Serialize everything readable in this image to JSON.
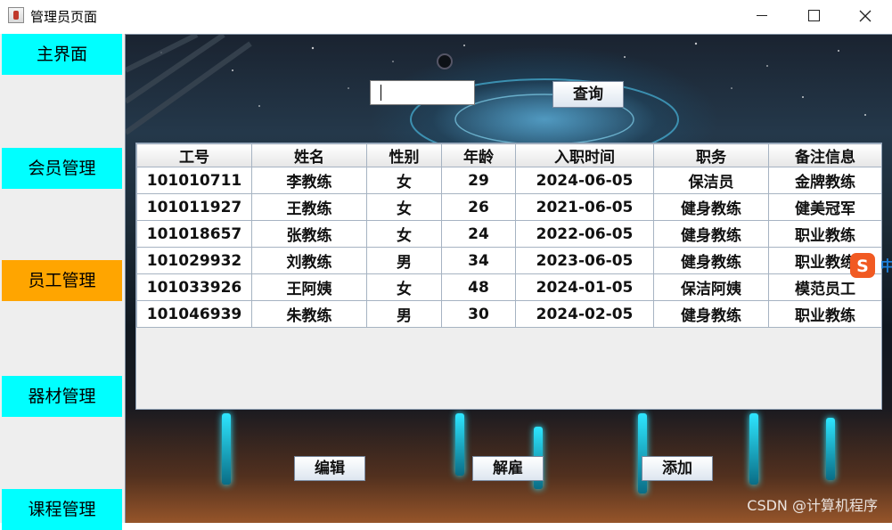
{
  "window": {
    "title": "管理员页面",
    "min_icon": "minimize-icon",
    "max_icon": "maximize-icon",
    "close_icon": "close-icon"
  },
  "sidebar": {
    "items": [
      {
        "label": "主界面",
        "active": false
      },
      {
        "label": "会员管理",
        "active": false
      },
      {
        "label": "员工管理",
        "active": true
      },
      {
        "label": "器材管理",
        "active": false
      },
      {
        "label": "课程管理",
        "active": false
      }
    ],
    "color_default": "#00ffff",
    "color_active": "#ffa500"
  },
  "search": {
    "value": "",
    "button_label": "查询"
  },
  "table": {
    "columns": [
      "工号",
      "姓名",
      "性别",
      "年龄",
      "入职时间",
      "职务",
      "备注信息"
    ],
    "rows": [
      [
        "101010711",
        "李教练",
        "女",
        "29",
        "2024-06-05",
        "保洁员",
        "金牌教练"
      ],
      [
        "101011927",
        "王教练",
        "女",
        "26",
        "2021-06-05",
        "健身教练",
        "健美冠军"
      ],
      [
        "101018657",
        "张教练",
        "女",
        "24",
        "2022-06-05",
        "健身教练",
        "职业教练"
      ],
      [
        "101029932",
        "刘教练",
        "男",
        "34",
        "2023-06-05",
        "健身教练",
        "职业教练"
      ],
      [
        "101033926",
        "王阿姨",
        "女",
        "48",
        "2024-01-05",
        "保洁阿姨",
        "模范员工"
      ],
      [
        "101046939",
        "朱教练",
        "男",
        "30",
        "2024-02-05",
        "健身教练",
        "职业教练"
      ]
    ]
  },
  "actions": {
    "edit_label": "编辑",
    "fire_label": "解雇",
    "add_label": "添加"
  },
  "overlay": {
    "ime_text": "中",
    "watermark": "CSDN @计算机程序"
  }
}
